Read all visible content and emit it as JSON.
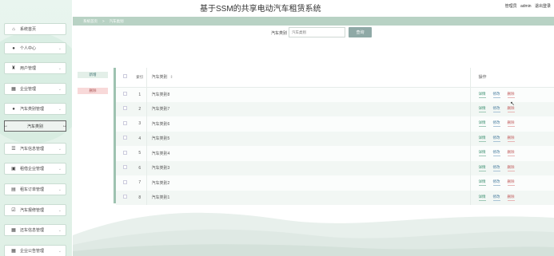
{
  "app_title": "基于SSM的共享电动汽车租赁系统",
  "header": {
    "user_role": "管理员",
    "username": "admin",
    "logout": "退出登录"
  },
  "breadcrumb": {
    "home": "系统首页",
    "separator": ">",
    "current": "汽车类别"
  },
  "search": {
    "label": "汽车类别",
    "placeholder": "汽车类别",
    "button": "查询"
  },
  "actions": {
    "add": "新增",
    "delete": "删除"
  },
  "sidebar": {
    "items": [
      {
        "label": "系统首页",
        "icon": "home-icon",
        "glyph": "⌂",
        "has_chevron": false
      },
      {
        "label": "个人中心",
        "icon": "person-icon",
        "glyph": "●",
        "has_chevron": true
      },
      {
        "label": "用户管理",
        "icon": "trophy-icon",
        "glyph": "♜",
        "has_chevron": true
      },
      {
        "label": "企业管理",
        "icon": "grid-icon",
        "glyph": "▦",
        "has_chevron": true
      },
      {
        "label": "汽车类别管理",
        "icon": "lightbulb-icon",
        "glyph": "●",
        "has_chevron": true,
        "expanded": true
      },
      {
        "label": "汽车信息管理",
        "icon": "list-icon",
        "glyph": "☰",
        "has_chevron": true
      },
      {
        "label": "租借企业管理",
        "icon": "building-icon",
        "glyph": "▣",
        "has_chevron": true
      },
      {
        "label": "租车订单管理",
        "icon": "printer-icon",
        "glyph": "▤",
        "has_chevron": true
      },
      {
        "label": "汽车报修管理",
        "icon": "checkbox-icon",
        "glyph": "☑",
        "has_chevron": true
      },
      {
        "label": "还车信息管理",
        "icon": "grid-icon",
        "glyph": "▦",
        "has_chevron": true
      },
      {
        "label": "企业公告管理",
        "icon": "grid-icon",
        "glyph": "▦",
        "has_chevron": true
      }
    ],
    "active_subitem": "汽车类别"
  },
  "table": {
    "headers": {
      "seq": "索引",
      "name": "汽车类别",
      "ops": "操作"
    },
    "rows": [
      {
        "seq": "1",
        "name": "汽车类别8"
      },
      {
        "seq": "2",
        "name": "汽车类别7"
      },
      {
        "seq": "3",
        "name": "汽车类别6"
      },
      {
        "seq": "4",
        "name": "汽车类别5"
      },
      {
        "seq": "5",
        "name": "汽车类别4"
      },
      {
        "seq": "6",
        "name": "汽车类别3"
      },
      {
        "seq": "7",
        "name": "汽车类别2"
      },
      {
        "seq": "8",
        "name": "汽车类别1"
      }
    ],
    "row_actions": {
      "detail": "详情",
      "edit": "修改",
      "delete": "删除"
    }
  },
  "colors": {
    "accent": "#b8d2c4",
    "sidebar_bg": "#e9f5ef",
    "search_button": "#8fa9a6",
    "delete_red": "#c05a5a",
    "detail_green": "#3b8f6f",
    "edit_blue": "#4c7fa0"
  }
}
